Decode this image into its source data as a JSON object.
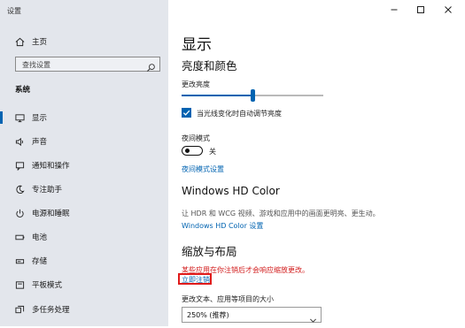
{
  "window": {
    "title": "设置"
  },
  "sidebar": {
    "home_label": "主页",
    "search_placeholder": "查找设置",
    "section_label": "系统",
    "items": [
      {
        "label": "显示",
        "icon": "monitor-icon"
      },
      {
        "label": "声音",
        "icon": "speaker-icon"
      },
      {
        "label": "通知和操作",
        "icon": "notification-icon"
      },
      {
        "label": "专注助手",
        "icon": "moon-icon"
      },
      {
        "label": "电源和睡眠",
        "icon": "power-icon"
      },
      {
        "label": "电池",
        "icon": "battery-icon"
      },
      {
        "label": "存储",
        "icon": "storage-icon"
      },
      {
        "label": "平板模式",
        "icon": "tablet-icon"
      },
      {
        "label": "多任务处理",
        "icon": "multitask-icon"
      }
    ]
  },
  "main": {
    "page_title": "显示",
    "brightness": {
      "heading": "亮度和颜色",
      "label": "更改亮度",
      "value_fraction": 0.5,
      "auto_adjust_label": "当光线变化时自动调节亮度",
      "auto_adjust_checked": true
    },
    "night_light": {
      "label": "夜间模式",
      "state_text": "关",
      "settings_link": "夜间模式设置"
    },
    "hd_color": {
      "heading": "Windows HD Color",
      "description": "让 HDR 和 WCG 视频、游戏和应用中的画面更明亮、更生动。",
      "settings_link": "Windows HD Color 设置"
    },
    "scale_layout": {
      "heading": "缩放与布局",
      "warning": "某些应用在你注销后才会响应缩放更改。",
      "signout_link": "立即注销",
      "size_label": "更改文本、应用等项目的大小",
      "size_value": "250% (推荐)"
    }
  },
  "colors": {
    "accent": "#0063b1",
    "warning": "#d21d1d",
    "sidebar_bg": "#e3e6ec"
  }
}
